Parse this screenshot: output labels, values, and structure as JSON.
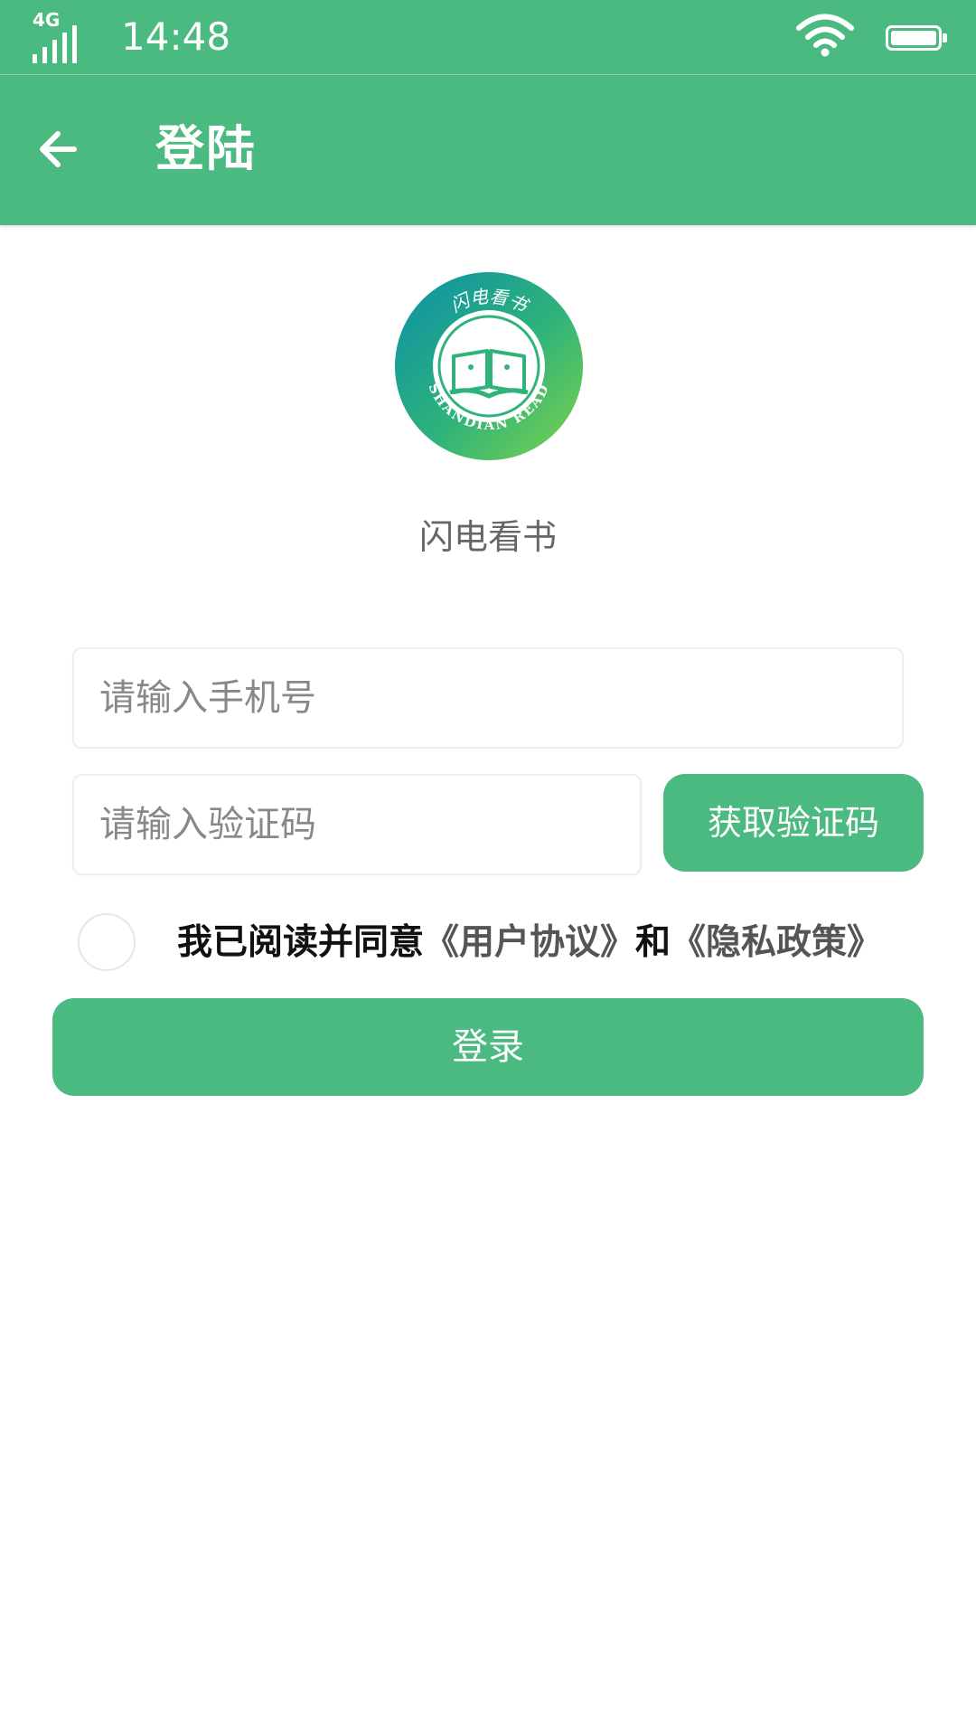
{
  "status_bar": {
    "network": "4G",
    "time": "14:48",
    "signal_icon": "signal-icon",
    "wifi_icon": "wifi-icon",
    "battery_icon": "battery-icon"
  },
  "app_bar": {
    "back_icon": "back-arrow-icon",
    "title": "登陆"
  },
  "brand": {
    "logo_text_top": "闪电看书",
    "logo_text_bottom": "SHANDIAN READ",
    "name": "闪电看书"
  },
  "form": {
    "phone_placeholder": "请输入手机号",
    "phone_value": "",
    "code_placeholder": "请输入验证码",
    "code_value": "",
    "get_code_label": "获取验证码"
  },
  "agreement": {
    "checked": false,
    "prefix": "我已阅读并同意",
    "user_agreement": "《用户协议》",
    "conjunction": "和",
    "privacy_policy": "《隐私政策》"
  },
  "login_label": "登录",
  "colors": {
    "brand_green": "#4aba80",
    "link_gray": "#555555"
  }
}
